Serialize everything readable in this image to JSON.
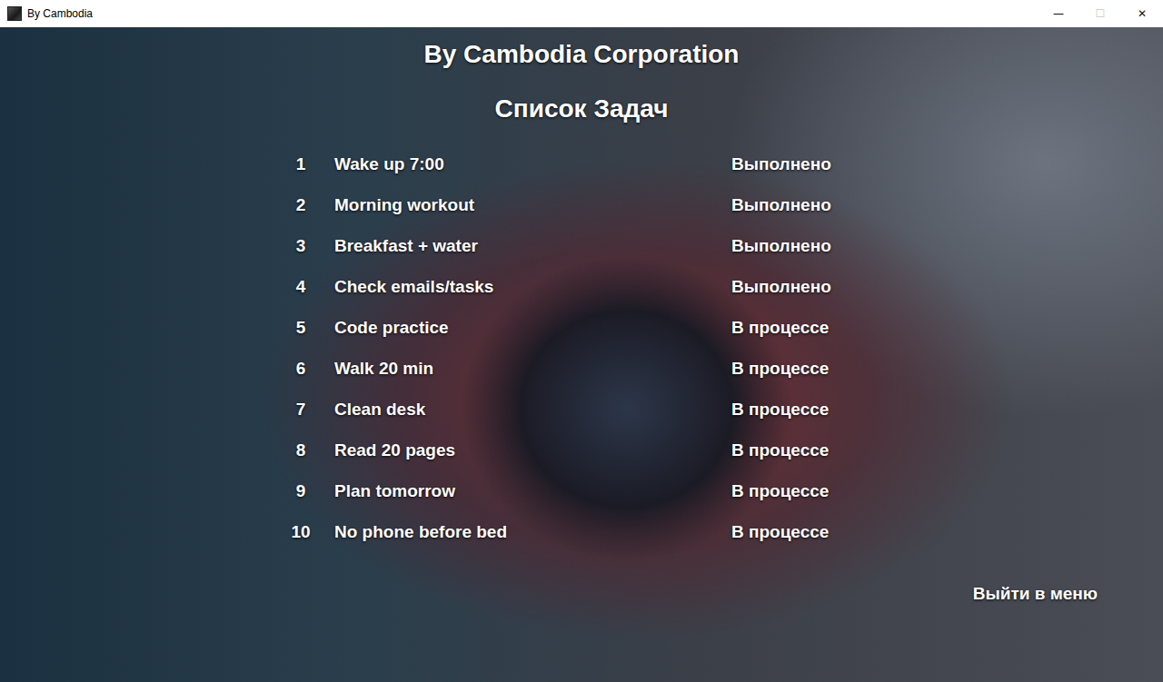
{
  "window": {
    "title": "By Cambodia",
    "controls": [
      {
        "label": "—",
        "disabled": false
      },
      {
        "label": "☐",
        "disabled": true
      },
      {
        "label": "✕",
        "disabled": false
      }
    ]
  },
  "header": {
    "title": "By Cambodia Corporation",
    "subtitle": "Список Задач"
  },
  "tasks": [
    {
      "number": "1",
      "title": "Wake up 7:00",
      "status": "Выполнено"
    },
    {
      "number": "2",
      "title": "Morning workout",
      "status": "Выполнено"
    },
    {
      "number": "3",
      "title": "Breakfast + water",
      "status": "Выполнено"
    },
    {
      "number": "4",
      "title": "Check emails/tasks",
      "status": "Выполнено"
    },
    {
      "number": "5",
      "title": "Code practice",
      "status": "В процессе"
    },
    {
      "number": "6",
      "title": "Walk 20 min",
      "status": "В процессе"
    },
    {
      "number": "7",
      "title": "Clean desk",
      "status": "В процессе"
    },
    {
      "number": "8",
      "title": "Read 20 pages",
      "status": "В процессе"
    },
    {
      "number": "9",
      "title": "Plan tomorrow",
      "status": "В процессе"
    },
    {
      "number": "10",
      "title": "No phone before bed",
      "status": "В процессе"
    }
  ],
  "buttons": [
    "Выйти в меню"
  ]
}
